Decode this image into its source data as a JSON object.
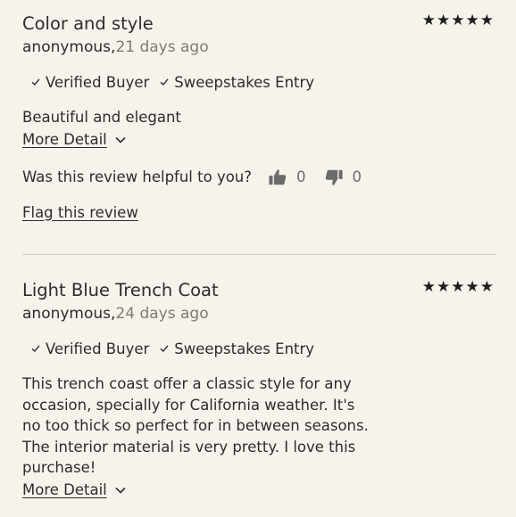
{
  "reviews": [
    {
      "title": "Color and style",
      "stars": "★★★★★",
      "author": "anonymous,",
      "date": "21 days ago",
      "badges": [
        "Verified Buyer",
        "Sweepstakes Entry"
      ],
      "body": "Beautiful and elegant",
      "more_label": "More Detail",
      "helpful_question": "Was this review helpful to you?",
      "up_count": "0",
      "down_count": "0",
      "flag_label": "Flag this review"
    },
    {
      "title": "Light Blue Trench Coat",
      "stars": "★★★★★",
      "author": "anonymous,",
      "date": "24 days ago",
      "badges": [
        "Verified Buyer",
        "Sweepstakes Entry"
      ],
      "body": "This trench coast offer a classic style for any occasion, specially for California weather. It's no too thick so perfect for in between seasons. The interior material is very pretty. I love this purchase!",
      "more_label": "More Detail"
    }
  ],
  "colors": {
    "background": "#f7f3ec",
    "text": "#2c2c2c",
    "muted": "#7e7a74",
    "divider": "#cfc9c0"
  },
  "icons": {
    "rating": "star-icon",
    "badge": "check-icon",
    "expand": "chevron-down-icon",
    "upvote": "thumbs-up-icon",
    "downvote": "thumbs-down-icon"
  }
}
